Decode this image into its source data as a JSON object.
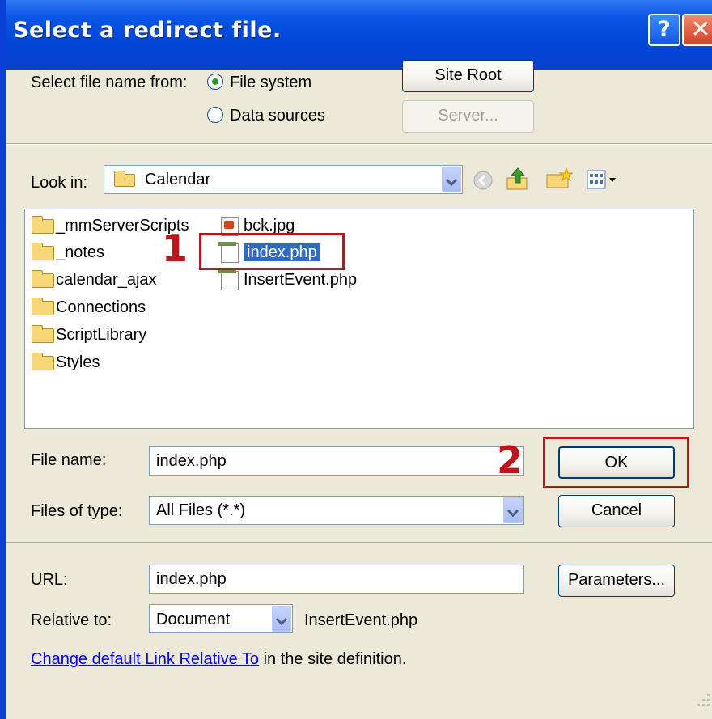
{
  "window": {
    "title": "Select a redirect file.",
    "help_glyph": "?",
    "close_glyph": "✕"
  },
  "source": {
    "label": "Select file name from:",
    "options": [
      "File system",
      "Data sources"
    ],
    "selected": "File system",
    "site_root_button": "Site Root",
    "server_button": "Server..."
  },
  "look_in": {
    "label": "Look in:",
    "value": "Calendar",
    "toolbar_icons": [
      "back-icon",
      "up-folder-icon",
      "new-folder-icon",
      "view-menu-icon"
    ]
  },
  "files": {
    "folders": [
      "_mmServerScripts",
      "_notes",
      "calendar_ajax",
      "Connections",
      "ScriptLibrary",
      "Styles"
    ],
    "items": [
      {
        "name": "bck.jpg",
        "icon": "jpg-file-icon"
      },
      {
        "name": "index.php",
        "icon": "php-file-icon",
        "selected": true
      },
      {
        "name": "InsertEvent.php",
        "icon": "php-file-icon"
      }
    ]
  },
  "annotations": {
    "marker1": "1",
    "marker2": "2",
    "color": "#b5161b"
  },
  "form": {
    "file_name_label": "File name:",
    "file_name_value": "index.php",
    "files_of_type_label": "Files of type:",
    "files_of_type_value": "All Files (*.*)",
    "ok_button": "OK",
    "cancel_button": "Cancel",
    "url_label": "URL:",
    "url_value": "index.php",
    "parameters_button": "Parameters...",
    "relative_to_label": "Relative to:",
    "relative_to_value": "Document",
    "relative_file": "InsertEvent.php",
    "link_text": "Change default Link Relative To",
    "link_suffix": " in the site definition."
  },
  "colors": {
    "title_bar": "#0a55e6",
    "dialog_bg": "#ece9d8",
    "selection": "#316ac5",
    "link": "#0000ee"
  }
}
